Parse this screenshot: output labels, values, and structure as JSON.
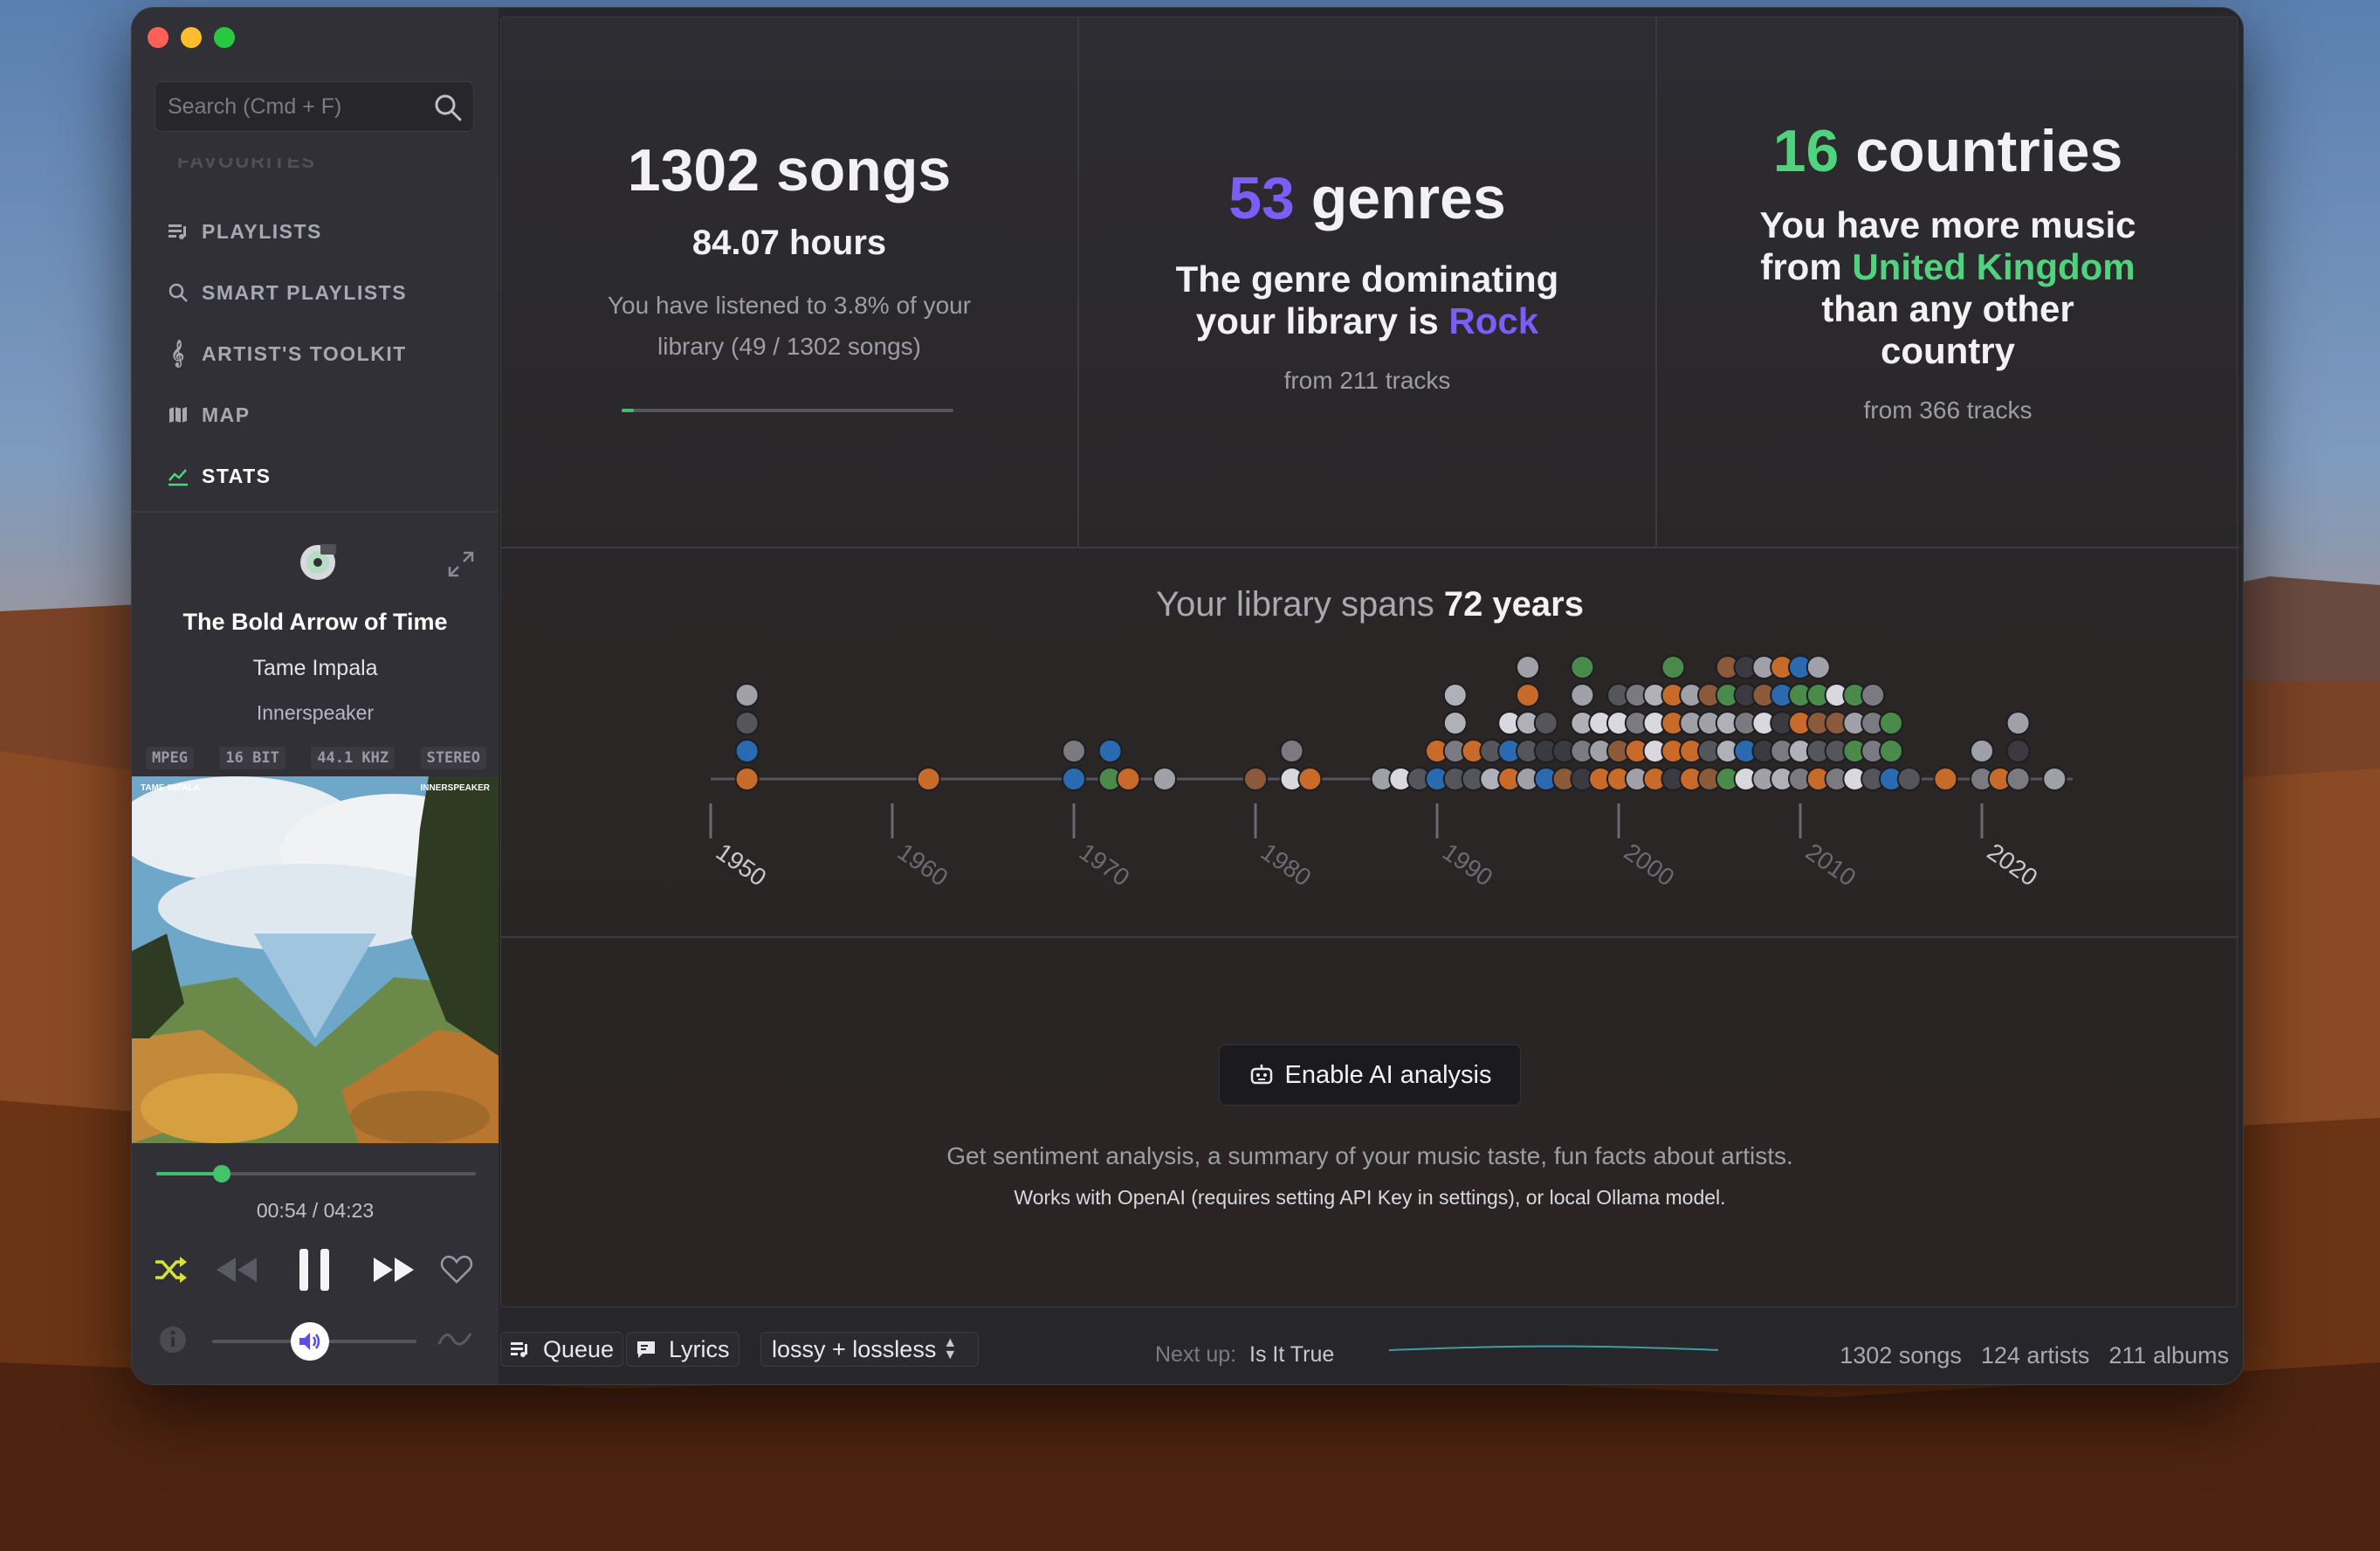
{
  "window": {
    "title": ""
  },
  "sidebar": {
    "search": {
      "placeholder": "Search (Cmd + F)",
      "value": ""
    },
    "faded_item": "FAVOURITES",
    "items": [
      {
        "label": "PLAYLISTS",
        "icon": "playlist-icon",
        "active": false
      },
      {
        "label": "SMART PLAYLISTS",
        "icon": "search-icon",
        "active": false
      },
      {
        "label": "ARTIST'S TOOLKIT",
        "icon": "treble-clef-icon",
        "active": false
      },
      {
        "label": "MAP",
        "icon": "map-icon",
        "active": false
      },
      {
        "label": "STATS",
        "icon": "chart-icon",
        "active": true
      }
    ]
  },
  "now_playing": {
    "title": "The Bold Arrow of Time",
    "artist": "Tame Impala",
    "album": "Innerspeaker",
    "tags": [
      "MPEG",
      "16 BIT",
      "44.1 KHZ",
      "STEREO"
    ],
    "artwork_text_left": "TAME IMPALA",
    "artwork_text_right": "INNERSPEAKER",
    "time": "00:54 / 04:23",
    "progress_fraction": 0.206,
    "volume_fraction": 0.48
  },
  "stats": {
    "songs": {
      "headline": "1302 songs",
      "hours": "84.07 hours",
      "listened_line1": "You have listened to 3.8% of your",
      "listened_line2": "library (49 / 1302 songs)",
      "listened_fraction": 0.038
    },
    "genres": {
      "count": "53",
      "word": " genres",
      "line1": "The genre dominating",
      "line2_prefix": "your library is ",
      "genre": "Rock",
      "from": "from 211 tracks"
    },
    "countries": {
      "count": "16",
      "word": " countries",
      "line1": "You have more music",
      "line2_prefix": "from ",
      "country": "United Kingdom",
      "line3": "than any other",
      "line4": "country",
      "from": "from 366 tracks"
    }
  },
  "timeline": {
    "spans_prefix": "Your library spans ",
    "spans_value": "72 years",
    "ticks": [
      "1950",
      "1960",
      "1970",
      "1980",
      "1990",
      "2000",
      "2010",
      "2020"
    ]
  },
  "ai": {
    "button": "Enable AI analysis",
    "description": "Get sentiment analysis, a summary of your music taste, fun facts about artists.",
    "note": "Works with OpenAI (requires setting API Key in settings), or local Ollama model."
  },
  "bottom_bar": {
    "queue": "Queue",
    "lyrics": "Lyrics",
    "quality": "lossy + lossless",
    "next_label": "Next up:",
    "next_title": "Is It True",
    "songs": "1302 songs",
    "artists": "124 artists",
    "albums": "211 albums"
  },
  "colors": {
    "accent_green": "#3fbf6b",
    "accent_purple": "#7b5ef7",
    "shuffle_yellow": "#d8e23a"
  }
}
